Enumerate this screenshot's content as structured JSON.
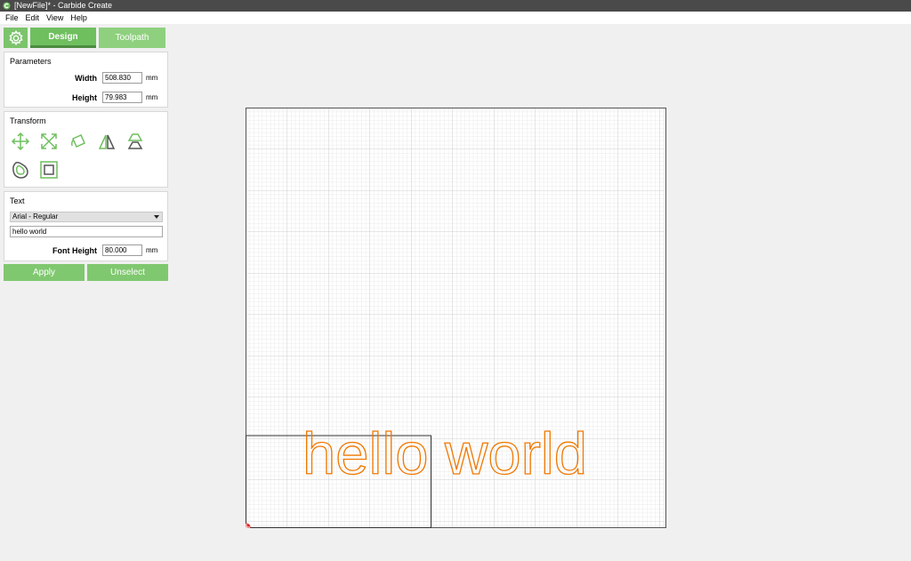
{
  "window": {
    "title": "[NewFile]* - Carbide Create"
  },
  "menu": [
    "File",
    "Edit",
    "View",
    "Help"
  ],
  "modes": {
    "design_label": "Design",
    "toolpath_label": "Toolpath"
  },
  "parameters": {
    "title": "Parameters",
    "width_label": "Width",
    "width_value": "508.830",
    "height_label": "Height",
    "height_value": "79.983",
    "unit": "mm"
  },
  "transform": {
    "title": "Transform"
  },
  "text_panel": {
    "title": "Text",
    "font_select": "Arial - Regular",
    "text_value": "hello world",
    "font_height_label": "Font Height",
    "font_height_value": "80.000",
    "unit": "mm"
  },
  "actions": {
    "apply_label": "Apply",
    "unselect_label": "Unselect"
  },
  "canvas": {
    "text": "hello world",
    "text_outline_color": "#f07800",
    "grid_color": "#cfcfcf",
    "origin_color": "#e02020"
  },
  "colors": {
    "accent": "#7cc46c",
    "titlebar": "#4a4a4a"
  }
}
